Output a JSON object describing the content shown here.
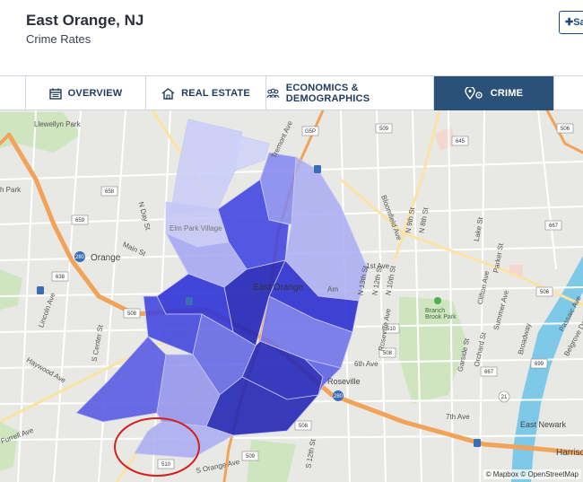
{
  "header": {
    "city": "East Orange, NJ",
    "subtitle": "Crime Rates",
    "save_label": "Sa"
  },
  "tabs": [
    {
      "label": "OVERVIEW",
      "icon": "calendar-icon",
      "active": false
    },
    {
      "label": "REAL ESTATE",
      "icon": "house-icon",
      "active": false
    },
    {
      "label": "ECONOMICS & DEMOGRAPHICS",
      "icon": "people-icon",
      "active": false
    },
    {
      "label": "CRIME",
      "icon": "location-pins-icon",
      "active": true
    }
  ],
  "map": {
    "attribution": "© Mapbox © OpenStreetMap",
    "labels": {
      "llewellyn_park": "Llewellyn Park",
      "orange": "Orange",
      "east_orange": "East Orange",
      "roseville": "Roseville",
      "east_newark": "East Newark",
      "harrison": "Harriso",
      "branch_brook_park": "Branch Brook Park",
      "main_st": "Main St",
      "s_orange_ave": "S Orange Ave",
      "bloomfield_ave": "Bloomfield Ave",
      "park": "h Park",
      "haywood_ave": "Haywood Ave",
      "lincoln_ave": "Lincoln Ave",
      "s_center_st": "S Center St",
      "n_day_st": "N Day St",
      "seventh_ave": "7th Ave",
      "sixth_ave": "6th Ave",
      "first_ave": "1st Ave",
      "elm_park_village": "Elm Park Village",
      "tremont_ave": "Tremont Ave",
      "s_12th_st": "S 12th St",
      "n_12th_st": "N 12th St",
      "n_10th_st": "N 10th St",
      "n_9th_st": "N 9th St",
      "n_8th_st": "N 8th St",
      "lake_st": "Lake St",
      "parker_st": "Parker St",
      "clifton_ave": "Clifton Ave",
      "summer_ave": "Summer Ave",
      "broadway": "Broadway",
      "passaic_ave": "Passaic Ave",
      "belgrove_dr": "Belgrove Dr",
      "roseville_ave": "Roseville Ave",
      "garside_st": "Garside St",
      "orchard_st": "Orchard St",
      "n_13th_st": "N 13th St",
      "ampere": "Am",
      "furrell_ave": "Furrell Ave"
    },
    "route_shields": [
      "G5P",
      "509",
      "645",
      "506",
      "638",
      "658",
      "659",
      "280",
      "280",
      "638",
      "508",
      "508",
      "508",
      "509",
      "509",
      "510",
      "508",
      "667",
      "506",
      "506",
      "21",
      "699",
      "667",
      "508",
      "508",
      "21",
      "508",
      "506",
      "510",
      "509",
      "510",
      "506",
      "508",
      "506",
      "509"
    ]
  },
  "colors": {
    "tab_active_bg": "#2c5178",
    "tab_text": "#1e3a5f",
    "highway": "#f2a35a",
    "water": "#7fc9e8",
    "park": "#cfe6c0",
    "crime_low": "#c5c8f8",
    "crime_high": "#1a1fa0",
    "annotation_circle": "#d42020"
  }
}
